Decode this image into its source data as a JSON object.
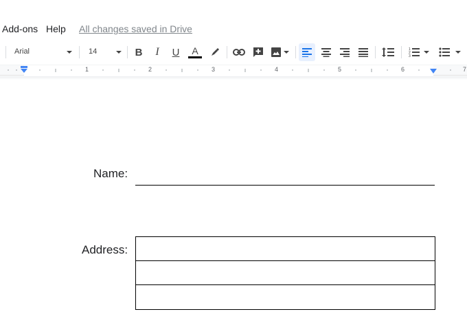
{
  "menu": {
    "addons": "Add-ons",
    "help": "Help",
    "saved_status": "All changes saved in Drive"
  },
  "toolbar": {
    "font": "Arial",
    "font_size": "14",
    "text_color": "#000000",
    "icons": [
      "bold-icon",
      "italic-icon",
      "underline-icon",
      "text-color-icon",
      "highlight-icon",
      "link-icon",
      "comment-icon",
      "image-icon",
      "align-left-icon",
      "align-center-icon",
      "align-right-icon",
      "align-justify-icon",
      "line-spacing-icon",
      "numbered-list-icon",
      "bulleted-list-icon"
    ],
    "active_alignment": "left"
  },
  "ruler": {
    "numbers": [
      "1",
      "2",
      "3",
      "4",
      "5",
      "6",
      "7"
    ]
  },
  "document": {
    "name_label": "Name:",
    "address_label": "Address:",
    "address_rows": 3
  },
  "colors": {
    "accent": "#4285f4",
    "active_bg": "#e8f0fe",
    "saved_text": "#80868b"
  }
}
